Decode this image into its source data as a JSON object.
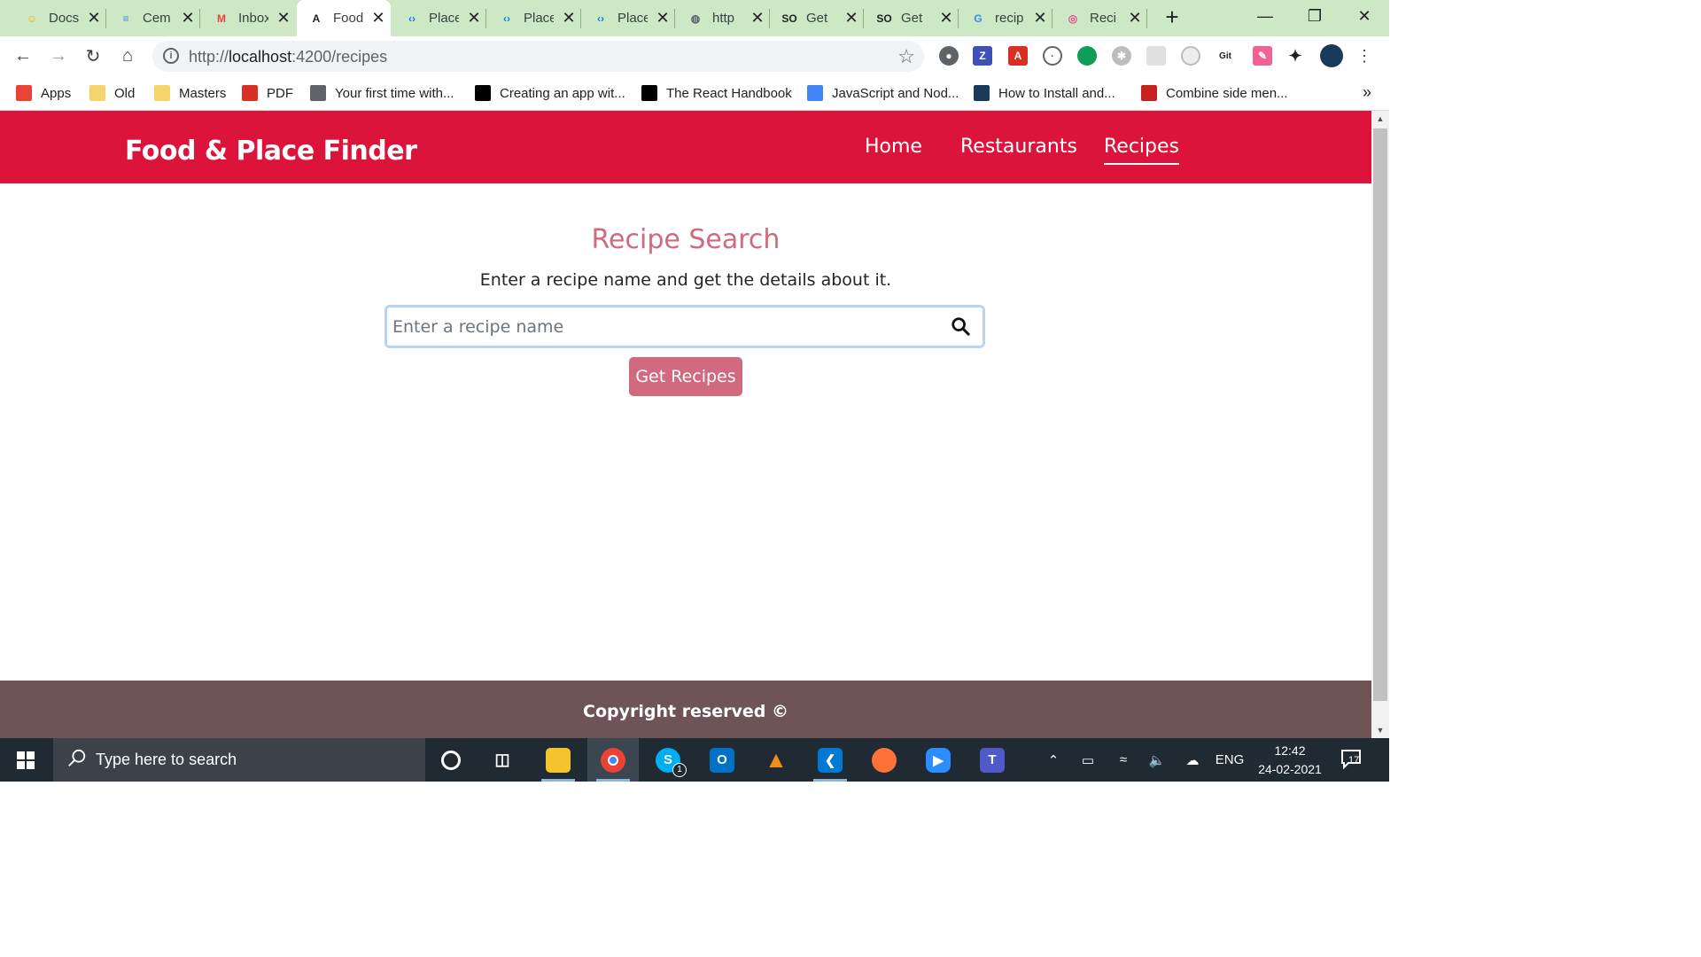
{
  "browser": {
    "tabs": [
      {
        "title": "Docs",
        "icon": "docs-smile-icon",
        "color": "#f9ab00",
        "glyph": "☺"
      },
      {
        "title": "Cem",
        "icon": "google-docs-icon",
        "color": "#4285f4",
        "glyph": "≡"
      },
      {
        "title": "Inbox",
        "icon": "gmail-icon",
        "color": "#ea4335",
        "glyph": "M"
      },
      {
        "title": "Food",
        "icon": "angular-icon",
        "color": "#202124",
        "glyph": "A"
      },
      {
        "title": "Place",
        "icon": "code-brackets-icon",
        "color": "#1a73e8",
        "glyph": "‹›"
      },
      {
        "title": "Place",
        "icon": "code-brackets-icon",
        "color": "#1a73e8",
        "glyph": "‹›"
      },
      {
        "title": "Place",
        "icon": "code-brackets-icon",
        "color": "#1a73e8",
        "glyph": "‹›"
      },
      {
        "title": "http",
        "icon": "globe-icon",
        "color": "#5f6368",
        "glyph": "◍"
      },
      {
        "title": "Get",
        "icon": "stackoverflow-icon",
        "color": "#202124",
        "glyph": "SO"
      },
      {
        "title": "Get",
        "icon": "stackoverflow-icon",
        "color": "#202124",
        "glyph": "SO"
      },
      {
        "title": "recip",
        "icon": "google-icon",
        "color": "#4285f4",
        "glyph": "G"
      },
      {
        "title": "Reci",
        "icon": "dribbble-icon",
        "color": "#ea4c89",
        "glyph": "◎"
      }
    ],
    "active_tab_index": 3,
    "url": {
      "scheme": "http://",
      "host": "localhost",
      "rest": ":4200/recipes"
    },
    "bookmarks": [
      {
        "label": "Apps",
        "icon": "apps-grid-icon",
        "color": "#ea4335"
      },
      {
        "label": "Old",
        "icon": "folder-icon",
        "color": "#f6d36b"
      },
      {
        "label": "Masters",
        "icon": "folder-icon",
        "color": "#f6d36b"
      },
      {
        "label": "PDF",
        "icon": "pdf-icon",
        "color": "#d93025"
      },
      {
        "label": "Your first time with...",
        "icon": "user-avatar-icon",
        "color": "#5f6368"
      },
      {
        "label": "Creating an app wit...",
        "icon": "dev-icon",
        "color": "#000000"
      },
      {
        "label": "The React Handbook",
        "icon": "flavio-icon",
        "color": "#000000"
      },
      {
        "label": "JavaScript and Nod...",
        "icon": "google-docs-icon",
        "color": "#4285f4"
      },
      {
        "label": "How to Install and...",
        "icon": "atom-icon",
        "color": "#1a3a5c"
      },
      {
        "label": "Combine side men...",
        "icon": "red-dots-icon",
        "color": "#c5221f"
      }
    ]
  },
  "app": {
    "brand": "Food & Place Finder",
    "nav": [
      {
        "label": "Home",
        "active": false
      },
      {
        "label": "Restaurants",
        "active": false
      },
      {
        "label": "Recipes",
        "active": true
      }
    ],
    "heading": "Recipe Search",
    "subtext": "Enter a recipe name and get the details about it.",
    "search_placeholder": "Enter a recipe name",
    "search_value": "",
    "button_label": "Get Recipes",
    "footer_text": "Copyright reserved ©",
    "colors": {
      "navbar": "#dc143c",
      "accent": "#d16a7f",
      "footer": "#6e5357"
    }
  },
  "taskbar": {
    "search_placeholder": "Type here to search",
    "time": "12:42",
    "date": "24-02-2021",
    "language": "ENG",
    "notification_count": "17",
    "skype_badge": "1"
  }
}
